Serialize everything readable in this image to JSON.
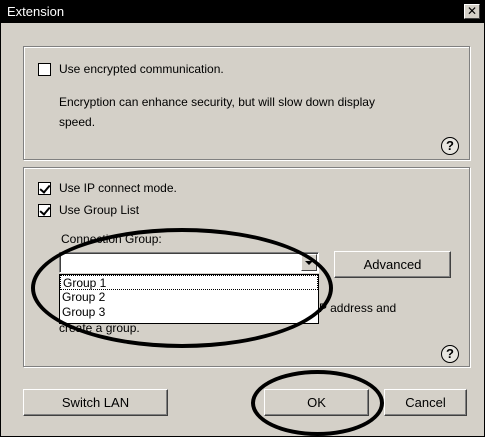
{
  "window": {
    "title": "Extension"
  },
  "encryption": {
    "checkbox_label": "Use encrypted communication.",
    "checked": false,
    "description_line1": "Encryption can enhance security, but will slow down display",
    "description_line2": "speed."
  },
  "ipmode": {
    "ip_connect_label": "Use IP connect mode.",
    "ip_connect_checked": true,
    "group_list_label": "Use Group List",
    "group_list_checked": true,
    "connection_group_label": "Connection Group:",
    "combo_value": "",
    "options": [
      "Group 1",
      "Group 2",
      "Group 3"
    ],
    "selected_option": "Group 1",
    "advanced_label": "Advanced",
    "hint_right": "P address and",
    "hint_line2": "create a group."
  },
  "help": {
    "glyph": "?"
  },
  "buttons": {
    "switch_lan": "Switch LAN",
    "ok": "OK",
    "cancel": "Cancel"
  },
  "close_glyph": "✕"
}
